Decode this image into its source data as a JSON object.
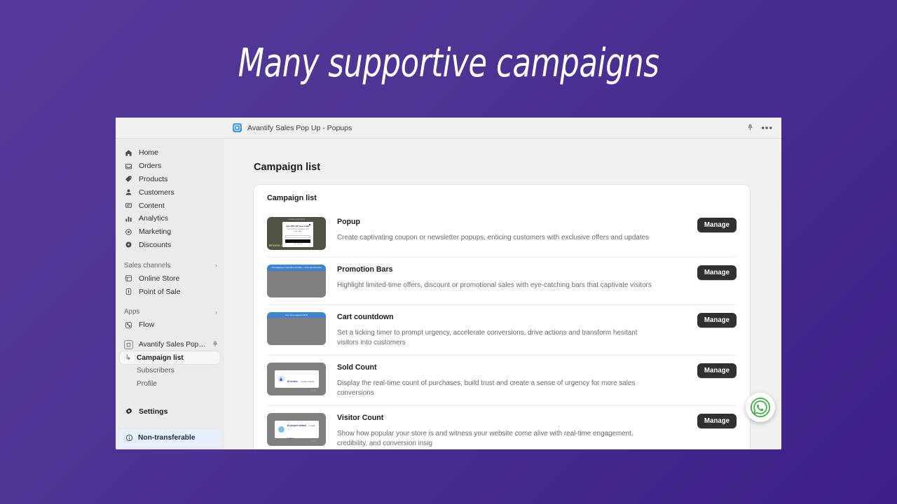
{
  "headline": "Many supportive campaigns",
  "topbar": {
    "app_title": "Avantify Sales Pop Up - Popups",
    "favicon_icon": "app-grid-icon",
    "pin_icon": "pin-icon",
    "more_icon": "more-horizontal-icon"
  },
  "sidebar": {
    "main_items": [
      {
        "label": "Home",
        "icon": "home-icon"
      },
      {
        "label": "Orders",
        "icon": "orders-inbox-icon"
      },
      {
        "label": "Products",
        "icon": "product-tag-icon"
      },
      {
        "label": "Customers",
        "icon": "customer-person-icon"
      },
      {
        "label": "Content",
        "icon": "content-icon"
      },
      {
        "label": "Analytics",
        "icon": "analytics-bars-icon"
      },
      {
        "label": "Marketing",
        "icon": "marketing-target-icon"
      },
      {
        "label": "Discounts",
        "icon": "discount-icon"
      }
    ],
    "sales_channels": {
      "label": "Sales channels",
      "chevron": "›",
      "items": [
        {
          "label": "Online Store",
          "icon": "online-store-icon"
        },
        {
          "label": "Point of Sale",
          "icon": "point-of-sale-icon"
        }
      ]
    },
    "apps": {
      "label": "Apps",
      "chevron": "›",
      "items": [
        {
          "label": "Flow",
          "icon": "flow-icon"
        }
      ]
    },
    "installed_app": {
      "name": "Avantify Sales Pop Up...",
      "icon": "app-icon",
      "pin_icon": "pin-icon",
      "sub_items": [
        {
          "label": "Campaign list",
          "active": true,
          "elbow": "↳"
        },
        {
          "label": "Subscribers",
          "active": false,
          "elbow": ""
        },
        {
          "label": "Profile",
          "active": false,
          "elbow": ""
        }
      ]
    },
    "settings": {
      "label": "Settings",
      "icon": "gear-icon"
    },
    "banner": {
      "label": "Non-transferable",
      "icon": "info-circle-icon"
    }
  },
  "main": {
    "page_title": "Campaign list",
    "card_title": "Campaign list",
    "manage_label": "Manage",
    "campaigns": [
      {
        "name": "Popup",
        "description": "Create captivating coupon or newsletter popups, enticing customers with exclusive offers and updates",
        "thumb_type": "popup",
        "thumb": {
          "header": "monthly popup demo",
          "left_text": "Browse our latest products",
          "modal_title": "Get 15% off your order",
          "modal_sub": "Sign up for our newsletter and save today",
          "modal_input_placeholder": "Email",
          "modal_button": "CLAIM DISCOUNT",
          "modal_footer": "No, thanks"
        }
      },
      {
        "name": "Promotion Bars",
        "description": "Highlight limited-time offers, discount or promotional sales with eye-catching bars that captivate visitors",
        "thumb_type": "bar",
        "thumb": {
          "bar_text": "Free shipping on all orders over $50 — shop now and save!"
        }
      },
      {
        "name": "Cart countdown",
        "description": "Set a ticking timer to prompt urgency, accelerate conversions, drive actions and transform hesitant visitors into customers",
        "thumb_type": "bar-short",
        "thumb": {
          "bar_text": "Your cart is reserved 09:52"
        }
      },
      {
        "name": "Sold Count",
        "description": "Display the real-time count of purchases, build trust and create a sense of urgency for more sales conversions",
        "thumb_type": "notif-bag",
        "thumb": {
          "line1": "16 orders",
          "line2": "in last 1 hours",
          "brand": "Avantify",
          "icon": "shopping-bag-icon"
        }
      },
      {
        "name": "Visitor Count",
        "description": "Show how popular your store is and witness your website come alive with real-time engagement, credibility, and conversion insig",
        "thumb_type": "notif-circle",
        "thumb": {
          "line1": "16 people visited",
          "line2": "in last 1 hours",
          "brand": "Avantify",
          "icon": "visitor-dot-icon"
        }
      }
    ]
  },
  "whatsapp": {
    "icon": "whatsapp-icon"
  },
  "colors": {
    "background_start": "#55399a",
    "background_end": "#3c2088",
    "sidebar": "#ebebeb",
    "content_bg": "#f1f1f1",
    "button_dark": "#303030",
    "banner_blue": "#e8f0fd",
    "whatsapp_green": "#4caf50"
  }
}
